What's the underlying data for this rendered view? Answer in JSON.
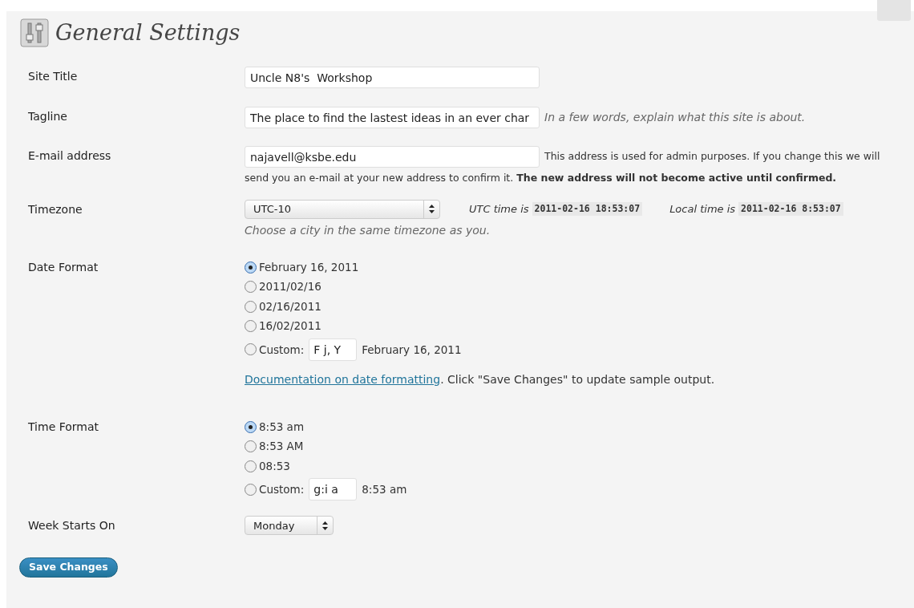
{
  "page": {
    "title": "General Settings"
  },
  "fields": [
    {
      "kind": "text",
      "label": "Site Title",
      "value": "Uncle N8's  Workshop"
    },
    {
      "kind": "text",
      "label": "Tagline",
      "value": "The place to find the lastest ideas in an ever char",
      "hint": "In a few words, explain what this site is about."
    },
    {
      "kind": "email",
      "label": "E-mail address",
      "value": "najavell@ksbe.edu",
      "description": "This address is used for admin purposes. If you change this we will",
      "description_continued": "send you an e-mail at your new address to confirm it. **The new address will not become active until confirmed.**"
    }
  ],
  "timezone": {
    "label": "Timezone",
    "value": "UTC-10",
    "utc_label": "UTC time is",
    "utc_time": "2011-02-16 18:53:07",
    "local_label": "Local time is",
    "local_time": "2011-02-16 8:53:07",
    "hint": "Choose a city in the same timezone as you."
  },
  "date_format": {
    "label": "Date Format",
    "options": [
      {
        "label": "February 16, 2011",
        "selected": true
      },
      {
        "label": "2011/02/16",
        "selected": false
      },
      {
        "label": "02/16/2011",
        "selected": false
      },
      {
        "label": "16/02/2011",
        "selected": false
      },
      {
        "kind": "custom",
        "label": "Custom:",
        "value": "F j, Y",
        "sample": "February 16, 2011",
        "selected": false
      }
    ],
    "doc_link": "Documentation on date formatting",
    "doc_note": ". Click \"Save Changes\" to update sample output."
  },
  "time_format": {
    "label": "Time Format",
    "options": [
      {
        "label": "8:53 am",
        "selected": true
      },
      {
        "label": "8:53 AM",
        "selected": false
      },
      {
        "label": "08:53",
        "selected": false
      },
      {
        "kind": "custom",
        "label": "Custom:",
        "value": "g:i a",
        "sample": "8:53 am",
        "selected": false
      }
    ]
  },
  "week_start": {
    "label": "Week Starts On",
    "value": "Monday"
  },
  "save_button": "Save Changes"
}
